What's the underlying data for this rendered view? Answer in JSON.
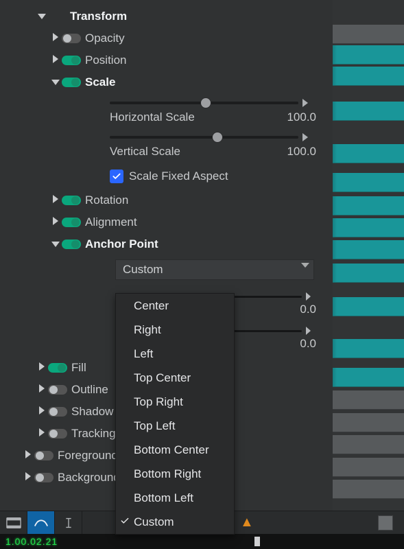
{
  "transform": {
    "title": "Transform",
    "items": {
      "opacity": {
        "label": "Opacity",
        "enabled": false
      },
      "position": {
        "label": "Position",
        "enabled": true
      },
      "scale": {
        "label": "Scale",
        "enabled": true,
        "horizontal": {
          "label": "Horizontal Scale",
          "value": "100.0",
          "thumb_pct": 48
        },
        "vertical": {
          "label": "Vertical Scale",
          "value": "100.0",
          "thumb_pct": 54
        },
        "fixed_aspect": {
          "label": "Scale Fixed Aspect",
          "checked": true
        }
      },
      "rotation": {
        "label": "Rotation",
        "enabled": true
      },
      "alignment": {
        "label": "Alignment",
        "enabled": true
      },
      "anchor": {
        "label": "Anchor Point",
        "enabled": true,
        "selected": "Custom",
        "options": [
          "Center",
          "Right",
          "Left",
          "Top Center",
          "Top Right",
          "Top Left",
          "Bottom Center",
          "Bottom Right",
          "Bottom Left",
          "Custom"
        ],
        "current_checked": "Custom",
        "x_value": "0.0",
        "y_value": "0.0"
      }
    }
  },
  "other_props": {
    "fill": {
      "label": "Fill",
      "enabled": true
    },
    "outline": {
      "label": "Outline",
      "enabled": false
    },
    "shadow": {
      "label": "Shadow",
      "enabled": false
    },
    "tracking": {
      "label": "Tracking",
      "enabled": false
    },
    "foreground": {
      "label": "Foreground",
      "enabled": false
    },
    "background": {
      "label": "Background",
      "enabled": false
    }
  },
  "timecode": "1.00.02.21"
}
